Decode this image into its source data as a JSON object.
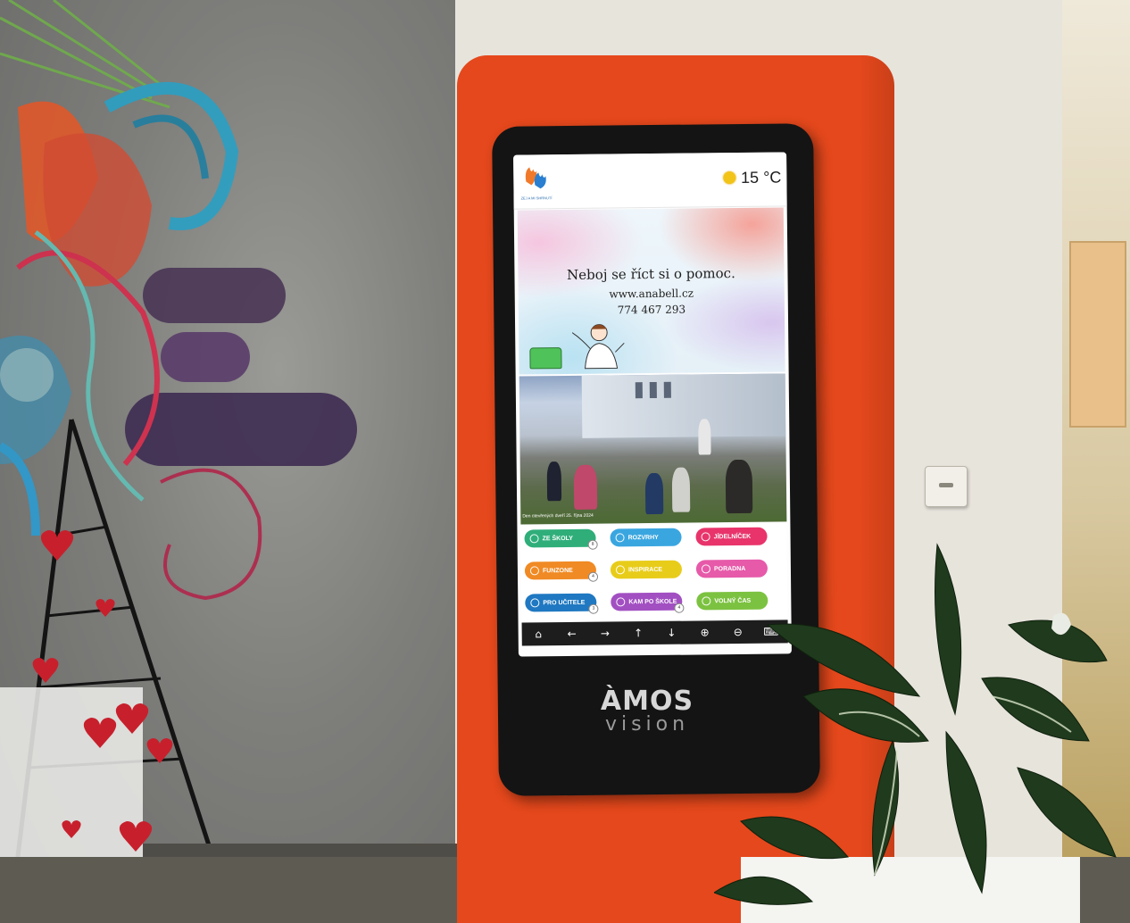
{
  "screen": {
    "logo_text": "ZEJ A MI SHRNUTÍ",
    "weather": {
      "icon": "sun-icon",
      "temperature": "15 °C",
      "icon_color": "#f2c418"
    },
    "banner": {
      "title": "Neboj se říct si o pomoc.",
      "url": "www.anabell.cz",
      "phone": "774 467 293"
    },
    "photo_caption": "Den otevřených dveří 25. října 2024",
    "tiles": [
      {
        "label": "ZE ŠKOLY",
        "color": "#2fae7a",
        "badge": "8"
      },
      {
        "label": "ROZVRHY",
        "color": "#3aa6e0",
        "badge": ""
      },
      {
        "label": "JÍDELNÍČEK",
        "color": "#e8346b",
        "badge": ""
      },
      {
        "label": "FUNZONE",
        "color": "#f08a24",
        "badge": "4"
      },
      {
        "label": "INSPIRACE",
        "color": "#e8cc1a",
        "badge": ""
      },
      {
        "label": "PORADNA",
        "color": "#e65aa9",
        "badge": ""
      },
      {
        "label": "PRO UČITELE",
        "color": "#1f78c1",
        "badge": "3"
      },
      {
        "label": "KAM PO ŠKOLE",
        "color": "#a24fc2",
        "badge": "4"
      },
      {
        "label": "VOLNÝ ČAS",
        "color": "#7cc241",
        "badge": ""
      }
    ],
    "navbar": [
      {
        "name": "home-icon",
        "glyph": "⌂"
      },
      {
        "name": "arrow-left-icon",
        "glyph": "←"
      },
      {
        "name": "arrow-right-icon",
        "glyph": "→"
      },
      {
        "name": "arrow-up-icon",
        "glyph": "↑"
      },
      {
        "name": "arrow-down-icon",
        "glyph": "↓"
      },
      {
        "name": "zoom-in-icon",
        "glyph": "⊕"
      },
      {
        "name": "zoom-out-icon",
        "glyph": "⊖"
      },
      {
        "name": "keyboard-icon",
        "glyph": "⌨"
      }
    ]
  },
  "kiosk": {
    "brand": "ÀMOS",
    "brand_sub": "vision",
    "panel_color": "#e5481c"
  }
}
